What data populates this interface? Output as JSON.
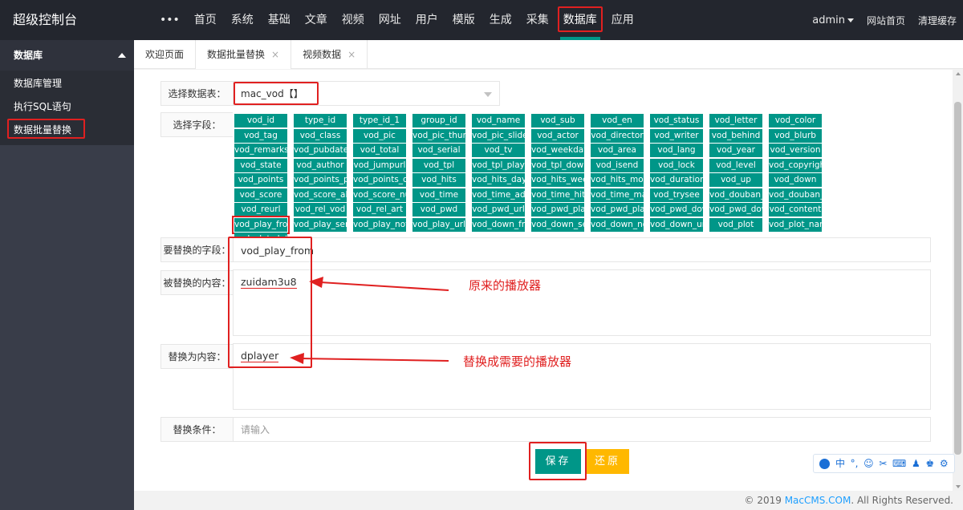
{
  "brand": "超级控制台",
  "nav": {
    "more": "•••",
    "items": [
      "首页",
      "系统",
      "基础",
      "文章",
      "视频",
      "网址",
      "用户",
      "模版",
      "生成",
      "采集",
      "数据库",
      "应用"
    ],
    "active_index": 10
  },
  "top_right": {
    "user": "admin",
    "site_home": "网站首页",
    "clear_cache": "清理缓存"
  },
  "sidebar": {
    "header": "数据库",
    "items": [
      "数据库管理",
      "执行SQL语句",
      "数据批量替换"
    ],
    "active_index": 2
  },
  "tabs": [
    {
      "label": "欢迎页面",
      "closable": false
    },
    {
      "label": "数据批量替换",
      "closable": true
    },
    {
      "label": "视频数据",
      "closable": true
    }
  ],
  "tab_close_glyph": "×",
  "form": {
    "table_label": "选择数据表：",
    "table_value": "mac_vod【】",
    "fields_label": "选择字段：",
    "replace_field_label": "要替换的字段：",
    "replace_field_value": "vod_play_from",
    "find_label": "被替换的内容：",
    "find_value": "zuidam3u8",
    "replace_label": "替换为内容：",
    "replace_value": "dplayer",
    "condition_label": "替换条件：",
    "condition_placeholder": "请输入",
    "save_label": "保存",
    "reset_label": "还原"
  },
  "field_tags": [
    "vod_id",
    "type_id",
    "type_id_1",
    "group_id",
    "vod_name",
    "vod_sub",
    "vod_en",
    "vod_status",
    "vod_letter",
    "vod_color",
    "vod_tag",
    "vod_class",
    "vod_pic",
    "vod_pic_thumb",
    "vod_pic_slide",
    "vod_actor",
    "vod_director",
    "vod_writer",
    "vod_behind",
    "vod_blurb",
    "vod_remarks",
    "vod_pubdate",
    "vod_total",
    "vod_serial",
    "vod_tv",
    "vod_weekday",
    "vod_area",
    "vod_lang",
    "vod_year",
    "vod_version",
    "vod_state",
    "vod_author",
    "vod_jumpurl",
    "vod_tpl",
    "vod_tpl_play",
    "vod_tpl_down",
    "vod_isend",
    "vod_lock",
    "vod_level",
    "vod_copyright",
    "vod_points",
    "vod_points_play",
    "vod_points_down",
    "vod_hits",
    "vod_hits_day",
    "vod_hits_week",
    "vod_hits_month",
    "vod_duration",
    "vod_up",
    "vod_down",
    "vod_score",
    "vod_score_all",
    "vod_score_num",
    "vod_time",
    "vod_time_add",
    "vod_time_hits",
    "vod_time_make",
    "vod_trysee",
    "vod_douban_id",
    "vod_douban_score",
    "vod_reurl",
    "vod_rel_vod",
    "vod_rel_art",
    "vod_pwd",
    "vod_pwd_url",
    "vod_pwd_play",
    "vod_pwd_play_url",
    "vod_pwd_down",
    "vod_pwd_down_url",
    "vod_content",
    "vod_play_from",
    "vod_play_server",
    "vod_play_note",
    "vod_play_url",
    "vod_down_from",
    "vod_down_server",
    "vod_down_note",
    "vod_down_url",
    "vod_plot",
    "vod_plot_name",
    "vod_plot_detail"
  ],
  "highlight_tag": "vod_play_from",
  "annotations": {
    "original_player": "原来的播放器",
    "new_player": "替换成需要的播放器"
  },
  "footer": {
    "prefix": "© 2019 ",
    "link": "MacCMS.COM",
    "suffix": ". All Rights Reserved."
  },
  "float_toolbar": [
    "中",
    "°,",
    "☺",
    "✂",
    "⌨",
    "♟",
    "♚",
    "⚙"
  ]
}
